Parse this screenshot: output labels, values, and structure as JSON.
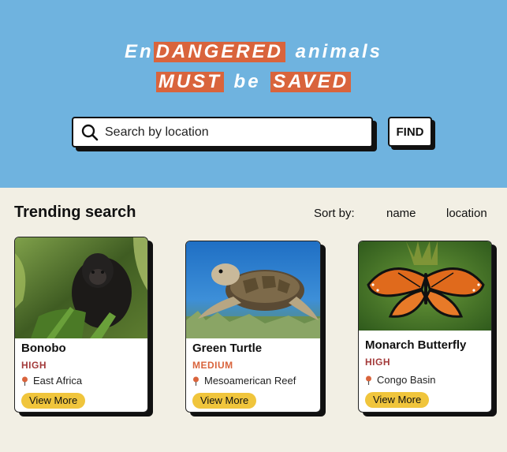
{
  "hero": {
    "line1_lead": "En",
    "line1_highlight": "DANGERED",
    "line1_tail": "animals",
    "line2_highlight_a": "MUST",
    "line2_middle": "be",
    "line2_highlight_b": "SAVED"
  },
  "search": {
    "placeholder": "Search by location",
    "button_label": "FIND"
  },
  "trending": {
    "title": "Trending search",
    "sort_label": "Sort by:",
    "sort_options": [
      "name",
      "location"
    ]
  },
  "cards": [
    {
      "name": "Bonobo",
      "level": "HIGH",
      "level_color": "#a33a3a",
      "location": "East Africa",
      "cta": "View More"
    },
    {
      "name": "Green Turtle",
      "level": "MEDIUM",
      "level_color": "#d9643c",
      "location": "Mesoamerican Reef",
      "cta": "View More"
    },
    {
      "name": "Monarch Butterfly",
      "level": "HIGH",
      "level_color": "#a33a3a",
      "location": "Congo Basin",
      "cta": "View More"
    }
  ],
  "colors": {
    "hero_bg": "#6fb3df",
    "highlight": "#d9643c",
    "page_bg": "#f2efe4",
    "cta_bg": "#f0c53c"
  }
}
